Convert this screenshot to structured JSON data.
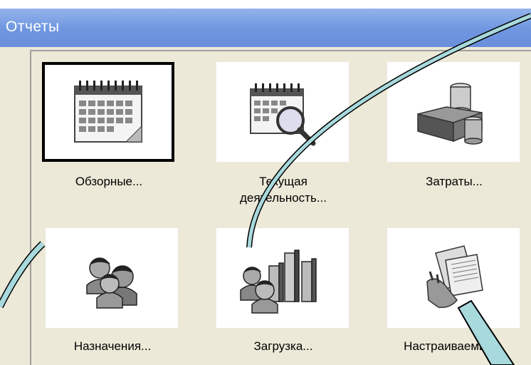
{
  "window": {
    "title": "Отчеты"
  },
  "reports": [
    {
      "label": "Обзорные...",
      "icon": "calendar-icon"
    },
    {
      "label": "Текущая деятельность...",
      "icon": "calendar-magnifier-icon"
    },
    {
      "label": "Затраты...",
      "icon": "money-coins-icon"
    },
    {
      "label": "Назначения...",
      "icon": "people-icon"
    },
    {
      "label": "Загрузка...",
      "icon": "people-bar-chart-icon"
    },
    {
      "label": "Настраиваемые...",
      "icon": "hand-documents-icon"
    }
  ],
  "colors": {
    "titlebar": "#7a9fe2",
    "dialog": "#ece9d8",
    "arrow_fill": "#a8d9dd"
  }
}
